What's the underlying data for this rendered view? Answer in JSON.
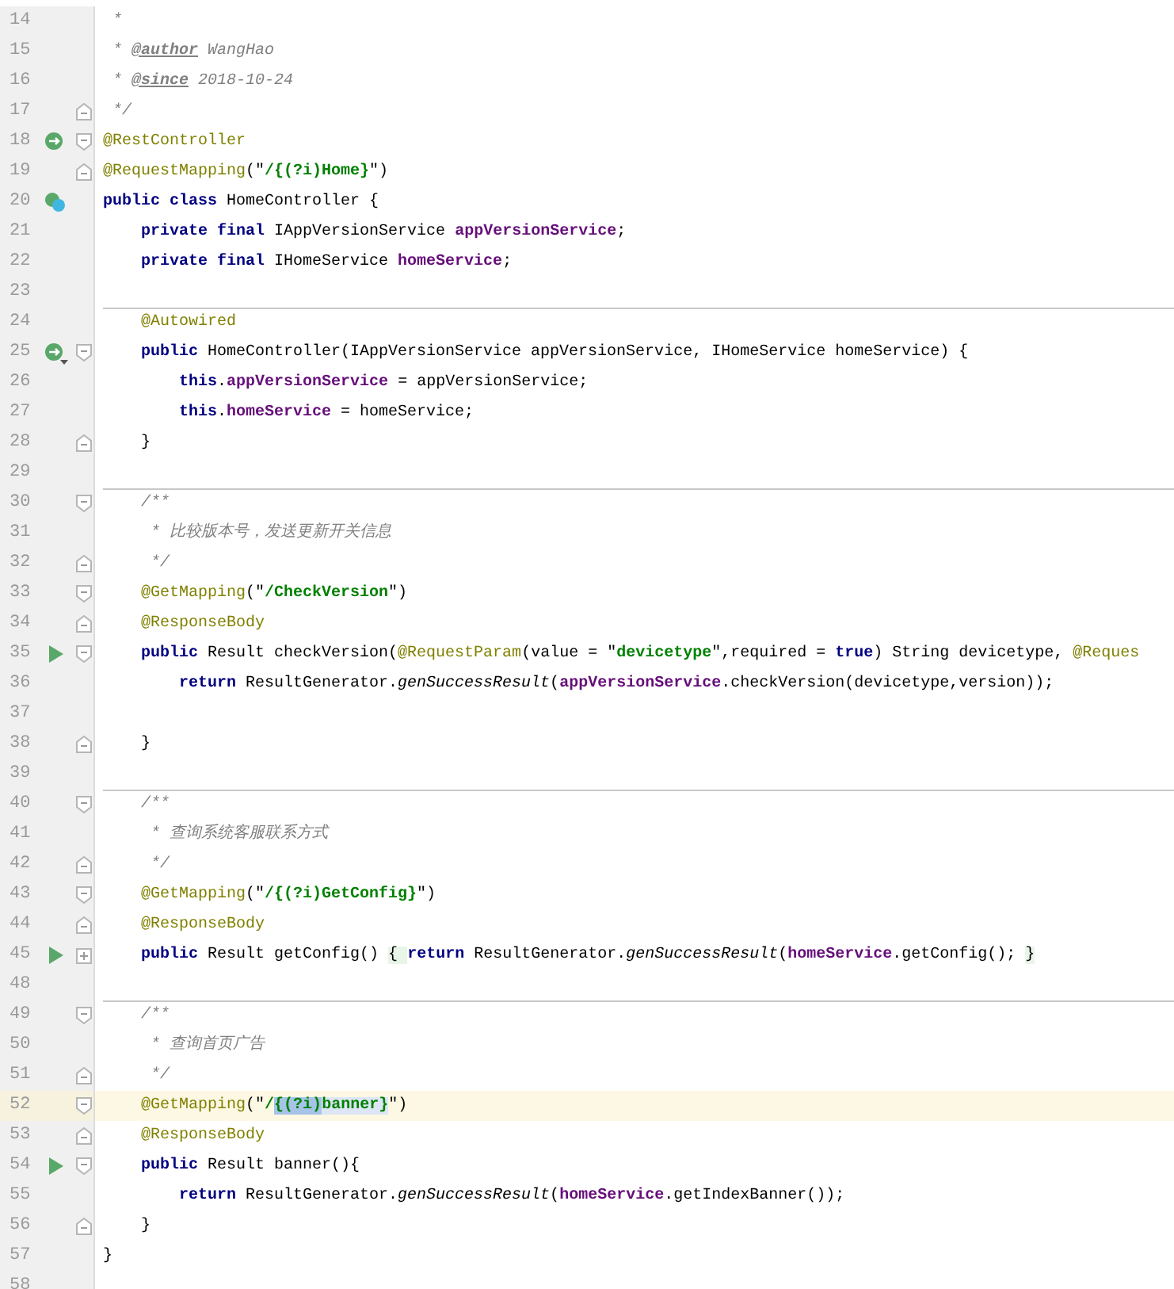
{
  "editor": {
    "lines": [
      {
        "number": "14",
        "tokens": [
          {
            "kind": "comment",
            "text": " *"
          }
        ]
      },
      {
        "number": "15",
        "tokens": [
          {
            "kind": "comment",
            "text": " * "
          },
          {
            "kind": "doctag",
            "text": "@author"
          },
          {
            "kind": "comment",
            "text": " WangHao"
          }
        ]
      },
      {
        "number": "16",
        "tokens": [
          {
            "kind": "comment",
            "text": " * "
          },
          {
            "kind": "doctag",
            "text": "@since"
          },
          {
            "kind": "comment",
            "text": " 2018-10-24"
          }
        ]
      },
      {
        "number": "17",
        "fold": {
          "kind": "end"
        },
        "tokens": [
          {
            "kind": "comment",
            "text": " */"
          }
        ]
      },
      {
        "number": "18",
        "gutter_icon": {
          "kind": "bean"
        },
        "fold": {
          "kind": "start"
        },
        "tokens": [
          {
            "kind": "annotation",
            "text": "@RestController"
          }
        ]
      },
      {
        "number": "19",
        "fold": {
          "kind": "end"
        },
        "tokens": [
          {
            "kind": "annotation",
            "text": "@RequestMapping"
          },
          {
            "kind": "plain",
            "text": "(\""
          },
          {
            "kind": "string",
            "text": "/{(?i)Home}"
          },
          {
            "kind": "plain",
            "text": "\")"
          }
        ]
      },
      {
        "number": "20",
        "gutter_icon": {
          "kind": "class"
        },
        "tokens": [
          {
            "kind": "keyword",
            "text": "public class "
          },
          {
            "kind": "plain",
            "text": "HomeController {"
          }
        ]
      },
      {
        "number": "21",
        "tokens": [
          {
            "kind": "keyword",
            "text": "    private final "
          },
          {
            "kind": "plain",
            "text": "IAppVersionService "
          },
          {
            "kind": "field",
            "text": "appVersionService"
          },
          {
            "kind": "plain",
            "text": ";"
          }
        ]
      },
      {
        "number": "22",
        "tokens": [
          {
            "kind": "keyword",
            "text": "    private final "
          },
          {
            "kind": "plain",
            "text": "IHomeService "
          },
          {
            "kind": "field",
            "text": "homeService"
          },
          {
            "kind": "plain",
            "text": ";"
          }
        ]
      },
      {
        "number": "23"
      },
      {
        "number": "24",
        "separator": true,
        "tokens": [
          {
            "kind": "annotation",
            "text": "    @Autowired"
          }
        ]
      },
      {
        "number": "25",
        "gutter_icon": {
          "kind": "beanmenu"
        },
        "fold": {
          "kind": "start"
        },
        "tokens": [
          {
            "kind": "keyword",
            "text": "    public "
          },
          {
            "kind": "plain",
            "text": "HomeController(IAppVersionService appVersionService, IHomeService homeService) {"
          }
        ]
      },
      {
        "number": "26",
        "tokens": [
          {
            "kind": "keyword",
            "text": "        this"
          },
          {
            "kind": "plain",
            "text": "."
          },
          {
            "kind": "field",
            "text": "appVersionService"
          },
          {
            "kind": "plain",
            "text": " = appVersionService;"
          }
        ]
      },
      {
        "number": "27",
        "tokens": [
          {
            "kind": "keyword",
            "text": "        this"
          },
          {
            "kind": "plain",
            "text": "."
          },
          {
            "kind": "field",
            "text": "homeService"
          },
          {
            "kind": "plain",
            "text": " = homeService;"
          }
        ]
      },
      {
        "number": "28",
        "fold": {
          "kind": "end"
        },
        "tokens": [
          {
            "kind": "plain",
            "text": "    }"
          }
        ]
      },
      {
        "number": "29"
      },
      {
        "number": "30",
        "separator": true,
        "fold": {
          "kind": "start"
        },
        "tokens": [
          {
            "kind": "comment",
            "text": "    /**"
          }
        ]
      },
      {
        "number": "31",
        "tokens": [
          {
            "kind": "comment",
            "text": "     * 比较版本号，发送更新开关信息"
          }
        ]
      },
      {
        "number": "32",
        "fold": {
          "kind": "end"
        },
        "tokens": [
          {
            "kind": "comment",
            "text": "     */"
          }
        ]
      },
      {
        "number": "33",
        "fold": {
          "kind": "start"
        },
        "tokens": [
          {
            "kind": "annotation",
            "text": "    @GetMapping"
          },
          {
            "kind": "plain",
            "text": "(\""
          },
          {
            "kind": "string",
            "text": "/CheckVersion"
          },
          {
            "kind": "plain",
            "text": "\")"
          }
        ]
      },
      {
        "number": "34",
        "fold": {
          "kind": "end"
        },
        "tokens": [
          {
            "kind": "annotation",
            "text": "    @ResponseBody"
          }
        ]
      },
      {
        "number": "35",
        "gutter_icon": {
          "kind": "run"
        },
        "fold": {
          "kind": "start"
        },
        "tokens": [
          {
            "kind": "keyword",
            "text": "    public "
          },
          {
            "kind": "plain",
            "text": "Result checkVersion("
          },
          {
            "kind": "annotation",
            "text": "@RequestParam"
          },
          {
            "kind": "plain",
            "text": "(value = \""
          },
          {
            "kind": "string",
            "text": "devicetype"
          },
          {
            "kind": "plain",
            "text": "\",required = "
          },
          {
            "kind": "keyword",
            "text": "true"
          },
          {
            "kind": "plain",
            "text": ") String devicetype, "
          },
          {
            "kind": "annotation",
            "text": "@Reques"
          }
        ]
      },
      {
        "number": "36",
        "tokens": [
          {
            "kind": "keyword",
            "text": "        return "
          },
          {
            "kind": "plain",
            "text": "ResultGenerator."
          },
          {
            "kind": "static",
            "text": "genSuccessResult"
          },
          {
            "kind": "plain",
            "text": "("
          },
          {
            "kind": "field",
            "text": "appVersionService"
          },
          {
            "kind": "plain",
            "text": ".checkVersion(devicetype,version));"
          }
        ]
      },
      {
        "number": "37"
      },
      {
        "number": "38",
        "fold": {
          "kind": "end"
        },
        "tokens": [
          {
            "kind": "plain",
            "text": "    }"
          }
        ]
      },
      {
        "number": "39"
      },
      {
        "number": "40",
        "separator": true,
        "fold": {
          "kind": "start"
        },
        "tokens": [
          {
            "kind": "comment",
            "text": "    /**"
          }
        ]
      },
      {
        "number": "41",
        "tokens": [
          {
            "kind": "comment",
            "text": "     * 查询系统客服联系方式"
          }
        ]
      },
      {
        "number": "42",
        "fold": {
          "kind": "end"
        },
        "tokens": [
          {
            "kind": "comment",
            "text": "     */"
          }
        ]
      },
      {
        "number": "43",
        "fold": {
          "kind": "start"
        },
        "tokens": [
          {
            "kind": "annotation",
            "text": "    @GetMapping"
          },
          {
            "kind": "plain",
            "text": "(\""
          },
          {
            "kind": "string",
            "text": "/{(?i)GetConfig}"
          },
          {
            "kind": "plain",
            "text": "\")"
          }
        ]
      },
      {
        "number": "44",
        "fold": {
          "kind": "end"
        },
        "tokens": [
          {
            "kind": "annotation",
            "text": "    @ResponseBody"
          }
        ]
      },
      {
        "number": "45",
        "gutter_icon": {
          "kind": "run"
        },
        "fold": {
          "kind": "collapsed"
        },
        "tokens": [
          {
            "kind": "keyword",
            "text": "    public "
          },
          {
            "kind": "plain",
            "text": "Result getConfig() "
          },
          {
            "kind": "folded",
            "text": "{ "
          },
          {
            "kind": "keyword",
            "text": "return "
          },
          {
            "kind": "plain",
            "text": "ResultGenerator."
          },
          {
            "kind": "static",
            "text": "genSuccessResult"
          },
          {
            "kind": "plain",
            "text": "("
          },
          {
            "kind": "field",
            "text": "homeService"
          },
          {
            "kind": "plain",
            "text": ".getConfig(); "
          },
          {
            "kind": "folded",
            "text": "}"
          }
        ]
      },
      {
        "number": "48"
      },
      {
        "number": "49",
        "separator": true,
        "fold": {
          "kind": "start"
        },
        "tokens": [
          {
            "kind": "comment",
            "text": "    /**"
          }
        ]
      },
      {
        "number": "50",
        "tokens": [
          {
            "kind": "comment",
            "text": "     * 查询首页广告"
          }
        ]
      },
      {
        "number": "51",
        "fold": {
          "kind": "end"
        },
        "tokens": [
          {
            "kind": "comment",
            "text": "     */"
          }
        ]
      },
      {
        "number": "52",
        "current": true,
        "fold": {
          "kind": "start"
        },
        "tokens": [
          {
            "kind": "annotation",
            "text": "    @GetMapping"
          },
          {
            "kind": "plain",
            "text": "(\""
          },
          {
            "kind": "string",
            "text": "/"
          },
          {
            "kind": "selection",
            "text": "{(?i)"
          },
          {
            "kind": "match",
            "text": "banner}"
          },
          {
            "kind": "plain",
            "text": "\")"
          }
        ]
      },
      {
        "number": "53",
        "fold": {
          "kind": "end"
        },
        "tokens": [
          {
            "kind": "annotation",
            "text": "    @ResponseBody"
          }
        ]
      },
      {
        "number": "54",
        "gutter_icon": {
          "kind": "run"
        },
        "fold": {
          "kind": "start"
        },
        "tokens": [
          {
            "kind": "keyword",
            "text": "    public "
          },
          {
            "kind": "plain",
            "text": "Result banner(){"
          }
        ]
      },
      {
        "number": "55",
        "tokens": [
          {
            "kind": "keyword",
            "text": "        return "
          },
          {
            "kind": "plain",
            "text": "ResultGenerator."
          },
          {
            "kind": "static",
            "text": "genSuccessResult"
          },
          {
            "kind": "plain",
            "text": "("
          },
          {
            "kind": "field",
            "text": "homeService"
          },
          {
            "kind": "plain",
            "text": ".getIndexBanner());"
          }
        ]
      },
      {
        "number": "56",
        "fold": {
          "kind": "end"
        },
        "tokens": [
          {
            "kind": "plain",
            "text": "    }"
          }
        ]
      },
      {
        "number": "57",
        "tokens": [
          {
            "kind": "plain",
            "text": "}"
          }
        ]
      },
      {
        "number": "58"
      }
    ]
  }
}
